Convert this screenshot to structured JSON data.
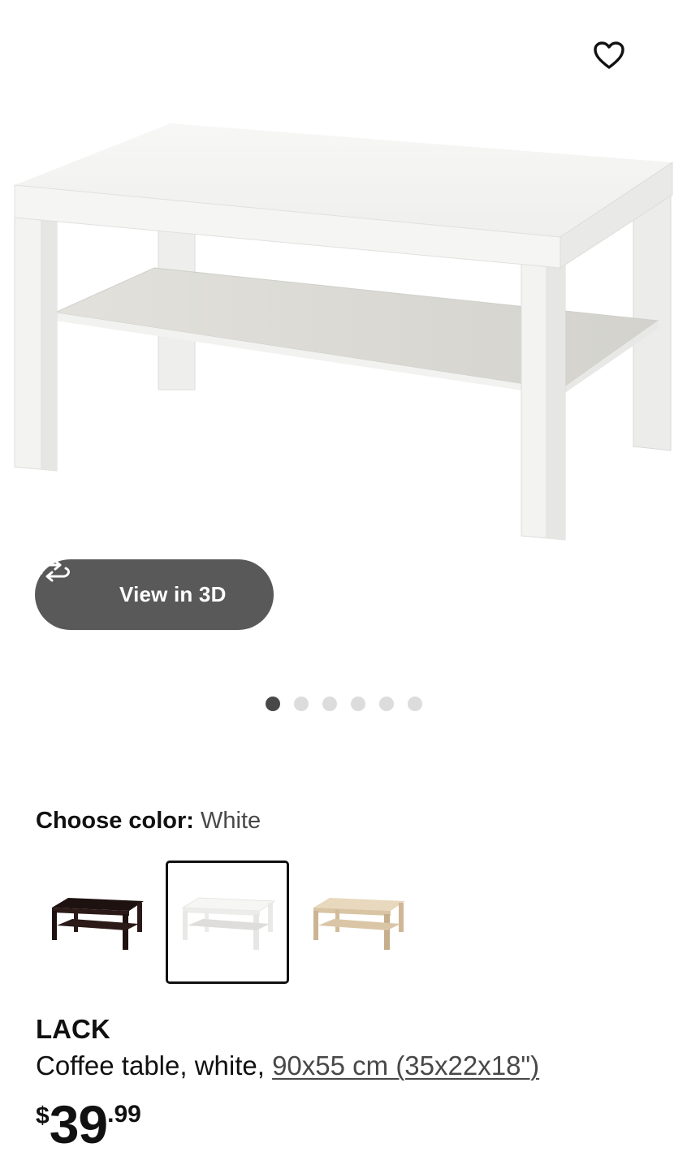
{
  "product": {
    "name": "LACK",
    "description": "Coffee table, white, ",
    "dimensions_link": "90x55 cm (35x22x18\")",
    "price": {
      "currency": "$",
      "integer": "39",
      "decimal": ".99"
    }
  },
  "gallery": {
    "view3d_label": "View in 3D",
    "total_images": 6,
    "active_index": 0
  },
  "color_chooser": {
    "label": "Choose color:",
    "selected_value": "White",
    "swatches": [
      {
        "color": "#2b1a18"
      },
      {
        "color": "#f4f4f2"
      },
      {
        "color": "#d9c4a4"
      }
    ],
    "selected_index": 1
  },
  "icons": {
    "favorite": "heart-icon",
    "rotate": "rotate-3d-icon"
  },
  "colors": {
    "button_bg": "#595959",
    "dot_active": "#484848",
    "dot_inactive": "#dcdcdc",
    "text": "#111111",
    "muted_text": "#484848"
  }
}
